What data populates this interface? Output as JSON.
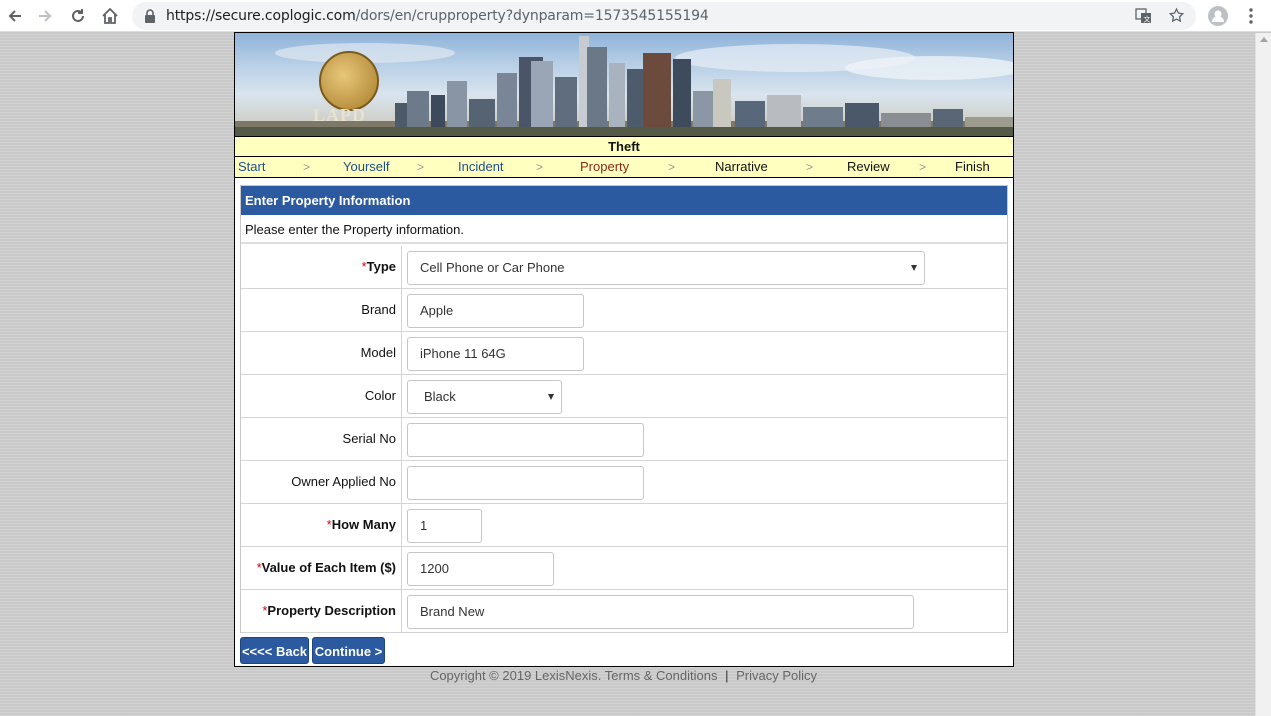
{
  "browser": {
    "url_scheme_host": "https://secure.coplogic.com",
    "url_path": "/dors/en/crupproperty?dynparam=1573545155194",
    "icons": [
      "back-arrow-icon",
      "forward-arrow-icon",
      "reload-icon",
      "home-icon",
      "lock-icon",
      "translate-icon",
      "star-icon",
      "account-icon",
      "menu-dots-icon"
    ]
  },
  "banner": {
    "badge_text": "LAPD"
  },
  "header": {
    "title": "Theft"
  },
  "steps": [
    {
      "label": "Start",
      "state": "done"
    },
    {
      "label": "Yourself",
      "state": "done"
    },
    {
      "label": "Incident",
      "state": "done"
    },
    {
      "label": "Property",
      "state": "current"
    },
    {
      "label": "Narrative",
      "state": "todo"
    },
    {
      "label": "Review",
      "state": "todo"
    },
    {
      "label": "Finish",
      "state": "todo"
    }
  ],
  "step_separator": ">",
  "panel": {
    "title": "Enter Property Information",
    "subtitle": "Please enter the Property information."
  },
  "form": {
    "required_marker": "*",
    "type": {
      "label": "Type",
      "value": "Cell Phone or Car Phone"
    },
    "brand": {
      "label": "Brand",
      "value": "Apple"
    },
    "model": {
      "label": "Model",
      "value": "iPhone 11 64G"
    },
    "color": {
      "label": "Color",
      "value": "Black"
    },
    "serial": {
      "label": "Serial No",
      "value": ""
    },
    "owner_no": {
      "label": "Owner Applied No",
      "value": ""
    },
    "how_many": {
      "label": "How Many",
      "value": "1"
    },
    "value_each": {
      "label": "Value of Each Item ($)",
      "value": "1200"
    },
    "description": {
      "label": "Property Description",
      "value": "Brand New"
    }
  },
  "buttons": {
    "back": "<<<< Back",
    "continue": "Continue >"
  },
  "footer": {
    "copyright": "Copyright ©  2019 LexisNexis.",
    "terms": "Terms & Conditions",
    "separator": "|",
    "privacy": "Privacy Policy"
  },
  "colors": {
    "accent": "#2c5aa0",
    "step_bar": "#ffffc0",
    "required": "#d40000",
    "current_step": "#8b2a1a",
    "done_step": "#1f4e8c"
  }
}
